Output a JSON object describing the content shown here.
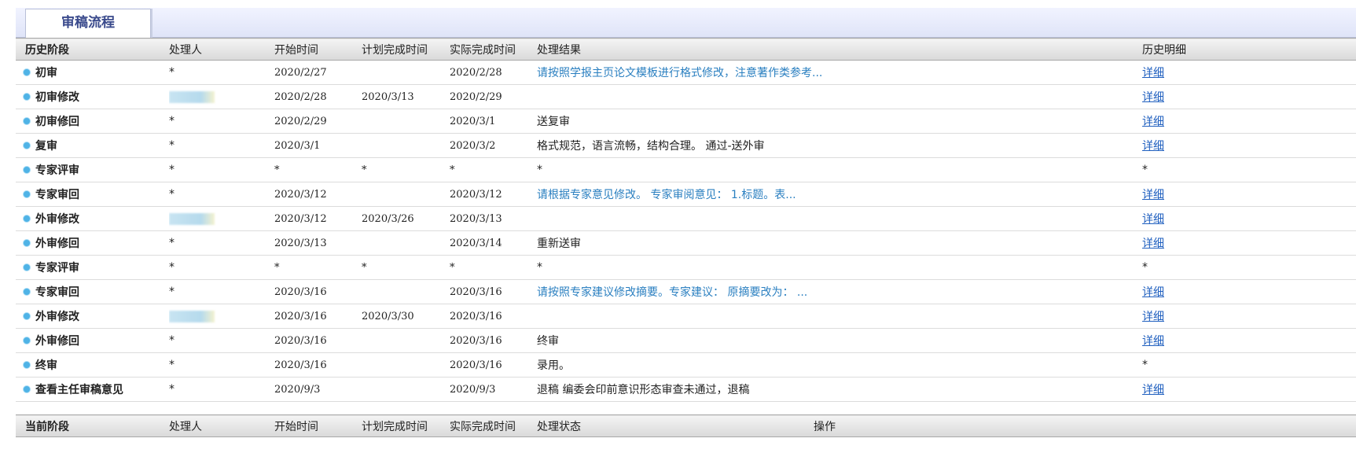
{
  "tab": {
    "title": "审稿流程"
  },
  "history": {
    "headers": [
      "历史阶段",
      "处理人",
      "开始时间",
      "计划完成时间",
      "实际完成时间",
      "处理结果",
      "历史明细"
    ],
    "rows": [
      {
        "stage": "初审",
        "handler": "*",
        "start": "2020/2/27",
        "plan": "",
        "actual": "2020/2/28",
        "result": "请按照学报主页论文模板进行格式修改，注意著作类参考...",
        "result_link": true,
        "detail": "详细"
      },
      {
        "stage": "初审修改",
        "handler": "",
        "handler_blurred": true,
        "start": "2020/2/28",
        "plan": "2020/3/13",
        "actual": "2020/2/29",
        "result": "",
        "result_link": false,
        "detail": "详细"
      },
      {
        "stage": "初审修回",
        "handler": "*",
        "start": "2020/2/29",
        "plan": "",
        "actual": "2020/3/1",
        "result": "送复审",
        "result_link": false,
        "detail": "详细"
      },
      {
        "stage": "复审",
        "handler": "*",
        "start": "2020/3/1",
        "plan": "",
        "actual": "2020/3/2",
        "result": "格式规范，语言流畅，结构合理。 通过-送外审",
        "result_link": false,
        "detail": "详细"
      },
      {
        "stage": "专家评审",
        "handler": "*",
        "start": "*",
        "plan": "*",
        "actual": "*",
        "result": "*",
        "result_link": false,
        "detail": "*"
      },
      {
        "stage": "专家审回",
        "handler": "*",
        "start": "2020/3/12",
        "plan": "",
        "actual": "2020/3/12",
        "result": "请根据专家意见修改。 专家审阅意见： 1.标题。表...",
        "result_link": true,
        "detail": "详细"
      },
      {
        "stage": "外审修改",
        "handler": "",
        "handler_blurred": true,
        "start": "2020/3/12",
        "plan": "2020/3/26",
        "actual": "2020/3/13",
        "result": "",
        "result_link": false,
        "detail": "详细"
      },
      {
        "stage": "外审修回",
        "handler": "*",
        "start": "2020/3/13",
        "plan": "",
        "actual": "2020/3/14",
        "result": "重新送审",
        "result_link": false,
        "detail": "详细"
      },
      {
        "stage": "专家评审",
        "handler": "*",
        "start": "*",
        "plan": "*",
        "actual": "*",
        "result": "*",
        "result_link": false,
        "detail": "*"
      },
      {
        "stage": "专家审回",
        "handler": "*",
        "start": "2020/3/16",
        "plan": "",
        "actual": "2020/3/16",
        "result": "请按照专家建议修改摘要。专家建议： 原摘要改为： ...",
        "result_link": true,
        "detail": "详细"
      },
      {
        "stage": "外审修改",
        "handler": "",
        "handler_blurred": true,
        "start": "2020/3/16",
        "plan": "2020/3/30",
        "actual": "2020/3/16",
        "result": "",
        "result_link": false,
        "detail": "详细"
      },
      {
        "stage": "外审修回",
        "handler": "*",
        "start": "2020/3/16",
        "plan": "",
        "actual": "2020/3/16",
        "result": "终审",
        "result_link": false,
        "detail": "详细"
      },
      {
        "stage": "终审",
        "handler": "*",
        "start": "2020/3/16",
        "plan": "",
        "actual": "2020/3/16",
        "result": "录用。",
        "result_link": false,
        "detail": "*"
      },
      {
        "stage": "查看主任审稿意见",
        "handler": "*",
        "start": "2020/9/3",
        "plan": "",
        "actual": "2020/9/3",
        "result": "退稿 编委会印前意识形态审查未通过，退稿",
        "result_link": false,
        "detail": "详细"
      }
    ]
  },
  "current": {
    "headers": [
      "当前阶段",
      "处理人",
      "开始时间",
      "计划完成时间",
      "实际完成时间",
      "处理状态",
      "操作"
    ]
  },
  "colors": {
    "accent_link": "#2a7fc0",
    "detail_link": "#1f5fbf",
    "dot": "#4fb3e6"
  },
  "icons": {
    "row_bullet": "circle-bullet-icon"
  }
}
